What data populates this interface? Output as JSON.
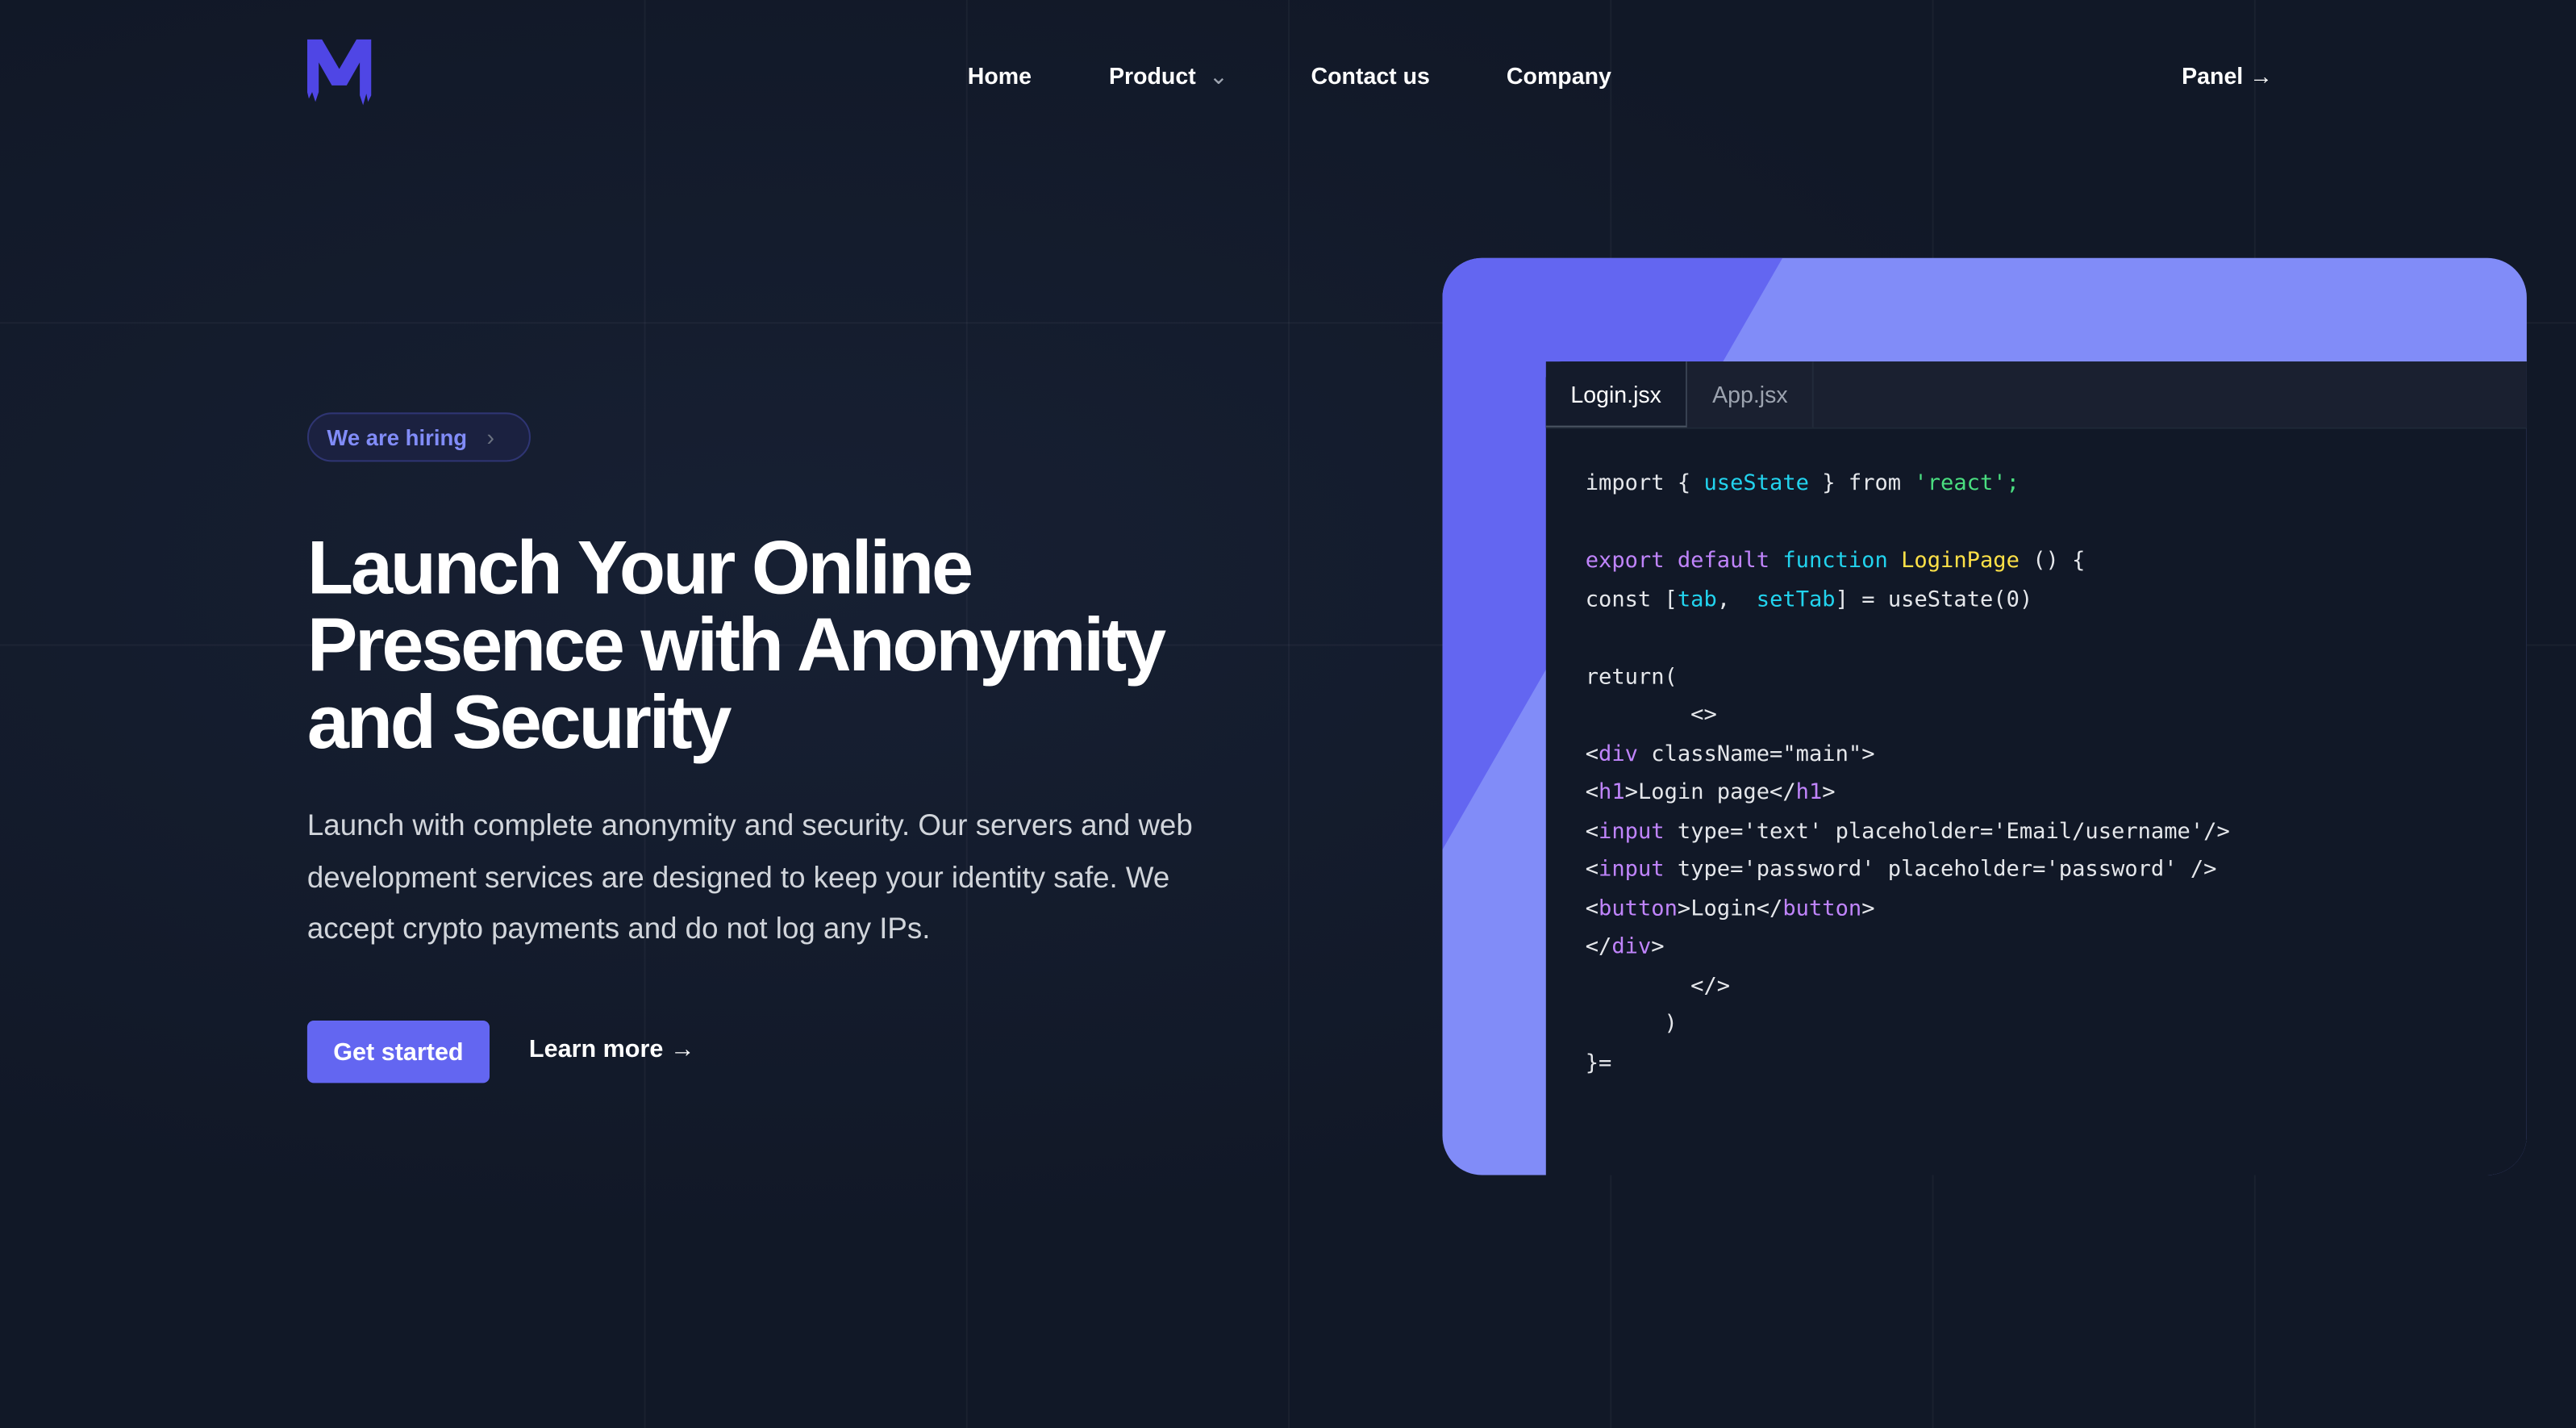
{
  "nav": {
    "brand": "M",
    "items": [
      "Home",
      "Product",
      "Contact us",
      "Company"
    ],
    "panel": "Panel →"
  },
  "hero": {
    "badge": "We are hiring",
    "title_lines": [
      "Launch Your Online",
      "Presence with Anonymity",
      "and Security"
    ],
    "lead": "Launch with complete anonymity and security. Our servers and web development services are designed to keep your identity safe. We accept crypto payments and do not log any IPs.",
    "primary": "Get started",
    "secondary": "Learn more →"
  },
  "editor": {
    "tabs": [
      "Login.jsx",
      "App.jsx"
    ],
    "lines": [
      [
        [
          "import { ",
          ""
        ],
        [
          "useState",
          "fn"
        ],
        [
          " } from ",
          ""
        ],
        [
          "'react';",
          "str"
        ]
      ],
      [],
      [
        [
          "export default ",
          "kw"
        ],
        [
          "function ",
          "fn"
        ],
        [
          "LoginPage",
          "name"
        ],
        [
          " () {",
          ""
        ]
      ],
      [
        [
          "const [",
          ""
        ],
        [
          "tab",
          "var"
        ],
        [
          ",  ",
          ""
        ],
        [
          "setTab",
          "var"
        ],
        [
          "] = useState(0)",
          ""
        ]
      ],
      [],
      [
        [
          "return(",
          ""
        ]
      ],
      [
        [
          "        <>",
          ""
        ]
      ],
      [
        [
          "<",
          ""
        ],
        [
          "div",
          "tag"
        ],
        [
          " className=\"main\">",
          ""
        ]
      ],
      [
        [
          "<",
          ""
        ],
        [
          "h1",
          "tag"
        ],
        [
          ">Login page</",
          ""
        ],
        [
          "h1",
          "tag"
        ],
        [
          ">",
          ""
        ]
      ],
      [
        [
          "<",
          ""
        ],
        [
          "input",
          "tag"
        ],
        [
          " type='text' placeholder='Email/username'/>",
          ""
        ]
      ],
      [
        [
          "<",
          ""
        ],
        [
          "input",
          "tag"
        ],
        [
          " type='password' placeholder='password' />",
          ""
        ]
      ],
      [
        [
          "<",
          ""
        ],
        [
          "button",
          "tag"
        ],
        [
          ">Login</",
          ""
        ],
        [
          "button",
          "tag"
        ],
        [
          ">",
          ""
        ]
      ],
      [
        [
          "</",
          ""
        ],
        [
          "div",
          "tag"
        ],
        [
          ">",
          ""
        ]
      ],
      [
        [
          "        </>",
          ""
        ]
      ],
      [
        [
          "      )",
          ""
        ]
      ],
      [
        [
          "}=",
          ""
        ]
      ]
    ]
  },
  "colors": {
    "bg": "#111827",
    "accent": "#6366f1",
    "accent_light": "#818cf8"
  }
}
